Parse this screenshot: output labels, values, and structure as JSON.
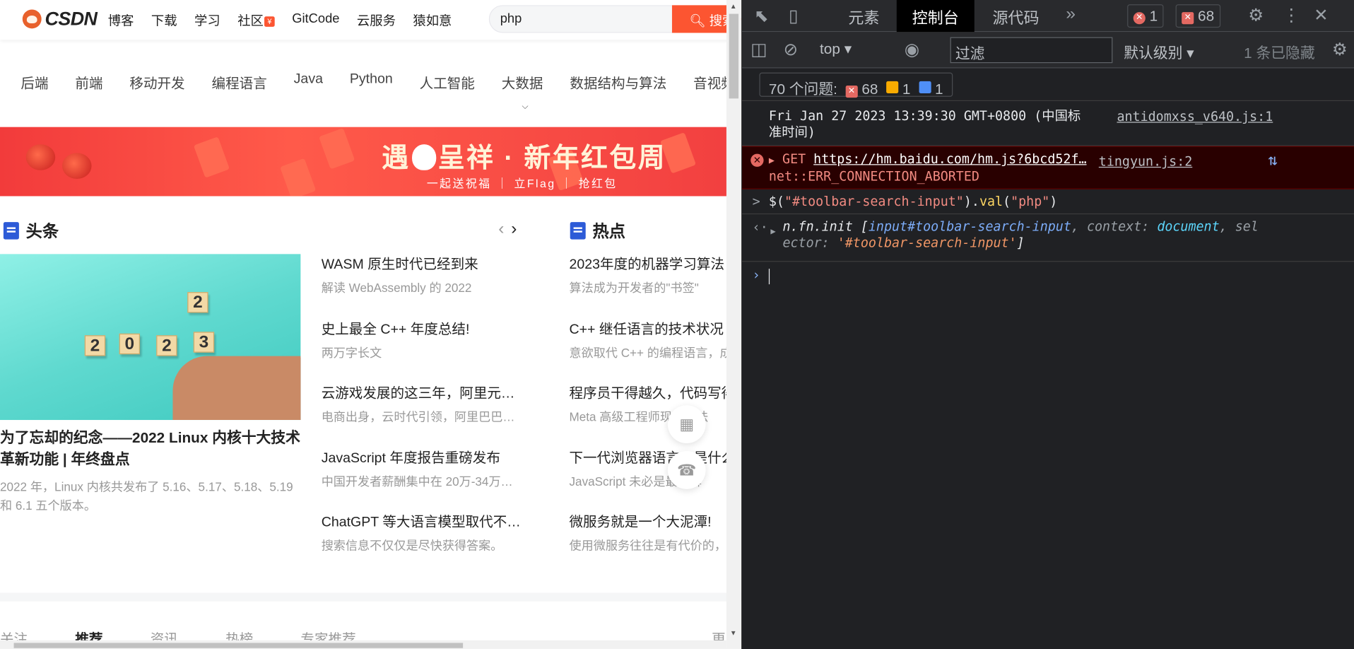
{
  "page": {
    "logo": {
      "brand": "CSDN"
    },
    "nav": [
      "博客",
      "下载",
      "学习",
      "社区",
      "GitCode",
      "云服务",
      "猿如意"
    ],
    "community_badge": "¥",
    "search": {
      "value": "php",
      "button_label": "搜索"
    },
    "categories": [
      "后端",
      "前端",
      "移动开发",
      "编程语言",
      "Java",
      "Python",
      "人工智能",
      "大数据",
      "数据结构与算法",
      "音视频"
    ],
    "banner": {
      "title_part1": "遇",
      "title_part2": "呈祥 · 新年红包周",
      "subtitle": "一起送祝福 ｜ 立Flag ｜ 抢红包"
    },
    "headline_section": {
      "title": "头条"
    },
    "hot_section": {
      "title": "热点"
    },
    "hero": {
      "cubes": [
        "2",
        "0",
        "2",
        "3",
        "2"
      ],
      "title": "为了忘却的纪念——2022 Linux 内核十大技术革新功能 | 年终盘点",
      "desc": "2022 年，Linux 内核共发布了 5.16、5.17、5.18、5.19 和 6.1 五个版本。"
    },
    "headlines": [
      {
        "title": "WASM 原生时代已经到来",
        "desc": "解读 WebAssembly 的 2022"
      },
      {
        "title": "史上最全 C++ 年度总结!",
        "desc": "两万字长文"
      },
      {
        "title": "云游戏发展的这三年，阿里元…",
        "desc": "电商出身，云时代引领，阿里巴巴…"
      },
      {
        "title": "JavaScript 年度报告重磅发布",
        "desc": "中国开发者薪酬集中在 20万-34万…"
      },
      {
        "title": "ChatGPT 等大语言模型取代不…",
        "desc": "搜索信息不仅仅是尽快获得答案。"
      }
    ],
    "hot": [
      {
        "title": "2023年度的机器学习算法",
        "desc": "算法成为开发者的\"书签\""
      },
      {
        "title": "C++ 继任语言的技术状况",
        "desc": "意欲取代 C++ 的编程语言，成"
      },
      {
        "title": "程序员干得越久，代码写得",
        "desc": "Meta 高级工程师现身说法"
      },
      {
        "title": "下一代浏览器语言，是什么",
        "desc": "JavaScript 未必是最优解"
      },
      {
        "title": "微服务就是一个大泥潭!",
        "desc": "使用微服务往往是有代价的，"
      }
    ],
    "feed_tabs": [
      "关注",
      "推荐",
      "资讯",
      "热榜",
      "专家推荐"
    ],
    "feed_active": "推荐",
    "feed_more": "更"
  },
  "devtools": {
    "tabs": [
      "元素",
      "控制台",
      "源代码"
    ],
    "active_tab": "控制台",
    "more_tabs_icon": "»",
    "error_count": "1",
    "issue_count": "68",
    "toolbar": {
      "context": "top",
      "filter_placeholder": "过滤",
      "level": "默认级别",
      "hidden": "1 条已隐藏"
    },
    "issues": {
      "label": "70 个问题:",
      "errors": "68",
      "warnings": "1",
      "info": "1"
    },
    "console": [
      {
        "type": "log",
        "text": "Fri Jan 27 2023 13:39:30 GMT+0800 (中国标",
        "text2": "准时间)",
        "source": "antidomxss_v640.js:1"
      },
      {
        "type": "error",
        "method": "GET",
        "url": "https://hm.baidu.com/hm.js?6bcd52f…",
        "detail": "net::ERR_CONNECTION_ABORTED",
        "source": "tingyun.js:2"
      },
      {
        "type": "input",
        "code_prefix": "$(",
        "code_arg": "\"#toolbar-search-input\"",
        "code_mid": ").",
        "code_fn": "val",
        "code_open": "(",
        "code_val": "\"php\"",
        "code_close": ")"
      },
      {
        "type": "result",
        "line1_obj": "n.fn.init",
        "line1_rest": " [",
        "line1_el": "input#toolbar-search-input",
        "line1_ctx": ", context: ",
        "line1_doc": "document",
        "line1_sel": ", sel",
        "line2_a": "ector: ",
        "line2_sel": "'#toolbar-search-input'",
        "line2_end": "]"
      }
    ],
    "colors": {
      "panel_bg": "#202124",
      "error_bg": "#290000",
      "accent": "#fc5531"
    }
  }
}
